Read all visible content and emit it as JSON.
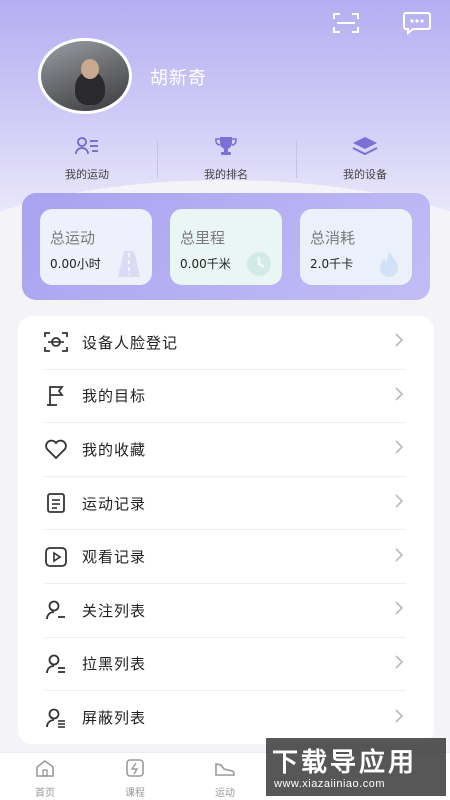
{
  "profile": {
    "username": "胡新奇"
  },
  "quick_nav": [
    {
      "label": "我的运动",
      "icon": "user-list-icon"
    },
    {
      "label": "我的排名",
      "icon": "trophy-icon"
    },
    {
      "label": "我的设备",
      "icon": "layers-icon"
    }
  ],
  "stats": [
    {
      "title": "总运动",
      "value": "0.00小时"
    },
    {
      "title": "总里程",
      "value": "0.00千米"
    },
    {
      "title": "总消耗",
      "value": "2.0千卡"
    }
  ],
  "menu": [
    {
      "label": "设备人脸登记",
      "icon": "face-scan-icon"
    },
    {
      "label": "我的目标",
      "icon": "flag-icon"
    },
    {
      "label": "我的收藏",
      "icon": "heart-icon"
    },
    {
      "label": "运动记录",
      "icon": "document-icon"
    },
    {
      "label": "观看记录",
      "icon": "play-icon"
    },
    {
      "label": "关注列表",
      "icon": "user-follow-icon"
    },
    {
      "label": "拉黑列表",
      "icon": "user-block-icon"
    },
    {
      "label": "屏蔽列表",
      "icon": "user-hide-icon"
    }
  ],
  "tabbar": [
    {
      "label": "首页",
      "icon": "home-icon"
    },
    {
      "label": "课程",
      "icon": "course-icon"
    },
    {
      "label": "运动",
      "icon": "shoe-icon"
    }
  ],
  "watermark": {
    "main": "下载导应用",
    "sub": "www.xiazaiiniao.com"
  },
  "colors": {
    "accent": "#8f86e8",
    "panel": "#a8a2f0",
    "background": "#f4f4f8"
  }
}
